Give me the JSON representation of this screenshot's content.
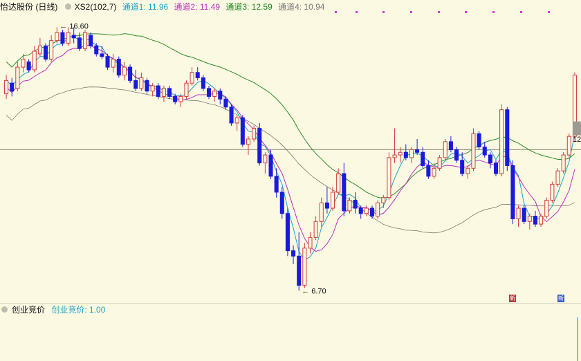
{
  "header": {
    "title": "怡达股份 (日线)",
    "indicator": "XS2(102,7)",
    "ch1": "通道1: 11.96",
    "ch2": "通道2: 11.49",
    "ch3": "通道3: 12.59",
    "ch4": "通道4: 10.94",
    "colors": {
      "ch1": "#1aa3c7",
      "ch2": "#bb2fbb",
      "ch3": "#1e8a1e",
      "ch4": "#777777"
    }
  },
  "annotations": {
    "high": "16.60",
    "low": "6.70",
    "right_price": "12"
  },
  "badges": {
    "b1": "新",
    "b2": "新"
  },
  "sub": {
    "title": "创业竞价",
    "value_label": "创业竞价: 1.00"
  },
  "chart_data": {
    "type": "candlestick",
    "price_range": [
      6.5,
      17.0
    ],
    "reference_line": 12.0,
    "candles": [
      [
        14.1,
        14.8,
        13.9,
        14.6
      ],
      [
        14.5,
        14.7,
        14.0,
        14.2
      ],
      [
        14.3,
        15.3,
        14.2,
        15.1
      ],
      [
        15.1,
        15.6,
        14.9,
        15.4
      ],
      [
        15.3,
        15.4,
        14.9,
        15.0
      ],
      [
        15.0,
        15.9,
        14.9,
        15.7
      ],
      [
        15.6,
        16.2,
        15.5,
        15.9
      ],
      [
        15.9,
        16.0,
        15.3,
        15.4
      ],
      [
        15.4,
        16.3,
        15.3,
        16.1
      ],
      [
        16.1,
        16.6,
        16.0,
        16.4
      ],
      [
        16.4,
        16.5,
        15.9,
        16.0
      ],
      [
        16.0,
        16.6,
        15.9,
        16.4
      ],
      [
        16.3,
        16.6,
        16.0,
        16.2
      ],
      [
        16.2,
        16.4,
        15.7,
        15.8
      ],
      [
        15.8,
        16.5,
        15.7,
        16.4
      ],
      [
        16.3,
        16.4,
        15.8,
        15.9
      ],
      [
        15.9,
        16.0,
        15.5,
        15.6
      ],
      [
        15.6,
        15.9,
        15.4,
        15.5
      ],
      [
        15.5,
        15.6,
        15.0,
        15.1
      ],
      [
        15.1,
        15.6,
        14.9,
        15.4
      ],
      [
        15.4,
        15.5,
        14.7,
        14.8
      ],
      [
        14.8,
        15.3,
        14.6,
        15.1
      ],
      [
        15.1,
        15.2,
        14.5,
        14.6
      ],
      [
        14.6,
        15.0,
        14.2,
        14.3
      ],
      [
        14.3,
        14.9,
        14.2,
        14.7
      ],
      [
        14.6,
        14.7,
        14.1,
        14.2
      ],
      [
        14.2,
        14.5,
        14.0,
        14.4
      ],
      [
        14.4,
        14.5,
        13.9,
        14.0
      ],
      [
        14.0,
        14.4,
        13.8,
        14.3
      ],
      [
        14.3,
        14.4,
        13.9,
        14.0
      ],
      [
        14.0,
        14.1,
        13.7,
        13.8
      ],
      [
        13.8,
        14.1,
        13.6,
        14.0
      ],
      [
        14.0,
        14.6,
        13.9,
        14.5
      ],
      [
        14.5,
        15.1,
        14.4,
        14.9
      ],
      [
        14.9,
        15.1,
        14.6,
        14.7
      ],
      [
        14.7,
        14.8,
        14.2,
        14.3
      ],
      [
        14.3,
        14.4,
        13.9,
        14.0
      ],
      [
        14.0,
        14.3,
        13.8,
        14.2
      ],
      [
        14.2,
        14.3,
        13.7,
        13.9
      ],
      [
        13.9,
        14.0,
        13.5,
        13.6
      ],
      [
        13.6,
        13.7,
        12.9,
        13.0
      ],
      [
        13.0,
        13.3,
        12.7,
        13.2
      ],
      [
        13.2,
        13.3,
        12.1,
        12.2
      ],
      [
        12.2,
        12.5,
        11.8,
        12.4
      ],
      [
        12.4,
        12.9,
        12.3,
        12.8
      ],
      [
        12.8,
        13.0,
        11.4,
        11.5
      ],
      [
        11.5,
        11.9,
        11.1,
        11.8
      ],
      [
        11.8,
        12.0,
        10.9,
        11.0
      ],
      [
        11.0,
        11.3,
        10.2,
        10.4
      ],
      [
        10.4,
        10.6,
        9.4,
        9.6
      ],
      [
        9.6,
        9.8,
        8.0,
        8.2
      ],
      [
        8.2,
        8.4,
        7.7,
        8.0
      ],
      [
        8.0,
        8.9,
        6.7,
        6.9
      ],
      [
        6.9,
        8.5,
        6.8,
        8.3
      ],
      [
        8.3,
        8.9,
        8.1,
        8.7
      ],
      [
        8.7,
        9.5,
        8.6,
        9.3
      ],
      [
        9.3,
        10.2,
        9.1,
        10.0
      ],
      [
        10.0,
        10.6,
        9.6,
        9.8
      ],
      [
        9.8,
        10.6,
        9.7,
        10.4
      ],
      [
        10.4,
        11.3,
        10.3,
        11.1
      ],
      [
        11.1,
        11.5,
        9.5,
        9.7
      ],
      [
        9.7,
        10.2,
        9.6,
        10.1
      ],
      [
        10.1,
        10.4,
        9.6,
        9.8
      ],
      [
        9.8,
        9.9,
        9.4,
        9.6
      ],
      [
        9.6,
        9.9,
        9.5,
        9.8
      ],
      [
        9.8,
        9.9,
        9.4,
        9.5
      ],
      [
        9.5,
        10.1,
        9.4,
        10.0
      ],
      [
        10.0,
        10.3,
        9.8,
        10.2
      ],
      [
        10.2,
        11.9,
        10.1,
        11.7
      ],
      [
        11.7,
        12.8,
        11.5,
        11.8
      ],
      [
        11.8,
        12.1,
        11.5,
        11.9
      ],
      [
        11.9,
        12.2,
        11.6,
        11.7
      ],
      [
        11.7,
        12.1,
        11.5,
        12.0
      ],
      [
        12.0,
        12.4,
        11.8,
        11.9
      ],
      [
        11.9,
        12.1,
        11.3,
        11.4
      ],
      [
        11.4,
        11.6,
        10.9,
        11.0
      ],
      [
        11.0,
        11.5,
        10.9,
        11.3
      ],
      [
        11.3,
        11.8,
        11.2,
        11.7
      ],
      [
        11.7,
        12.4,
        11.6,
        12.3
      ],
      [
        12.3,
        12.5,
        11.9,
        12.0
      ],
      [
        12.0,
        12.1,
        11.5,
        11.6
      ],
      [
        11.6,
        11.9,
        11.0,
        11.1
      ],
      [
        11.1,
        11.4,
        10.9,
        11.3
      ],
      [
        11.3,
        12.8,
        11.2,
        12.6
      ],
      [
        12.6,
        12.7,
        12.0,
        12.1
      ],
      [
        12.1,
        12.3,
        11.7,
        11.8
      ],
      [
        11.8,
        11.9,
        11.3,
        11.5
      ],
      [
        11.5,
        11.6,
        11.0,
        11.1
      ],
      [
        11.1,
        13.7,
        11.0,
        13.5
      ],
      [
        13.5,
        13.6,
        11.2,
        11.4
      ],
      [
        11.4,
        11.6,
        9.2,
        9.4
      ],
      [
        9.4,
        9.9,
        9.1,
        9.8
      ],
      [
        9.8,
        9.9,
        9.2,
        9.3
      ],
      [
        9.3,
        9.6,
        9.0,
        9.5
      ],
      [
        9.5,
        9.7,
        9.1,
        9.2
      ],
      [
        9.2,
        9.6,
        9.1,
        9.5
      ],
      [
        9.5,
        10.2,
        9.4,
        10.1
      ],
      [
        10.1,
        10.8,
        10.0,
        10.7
      ],
      [
        10.7,
        11.3,
        10.6,
        11.2
      ],
      [
        11.2,
        11.9,
        11.1,
        11.8
      ],
      [
        11.8,
        12.6,
        11.7,
        12.5
      ],
      [
        12.5,
        14.9,
        12.4,
        14.8
      ]
    ],
    "channels": {
      "ch1_name": "通道1",
      "ch2_name": "通道2",
      "ch3_name": "通道3",
      "ch4_name": "通道4"
    },
    "sub_series": {
      "name": "创业竞价",
      "value": 1.0
    }
  }
}
